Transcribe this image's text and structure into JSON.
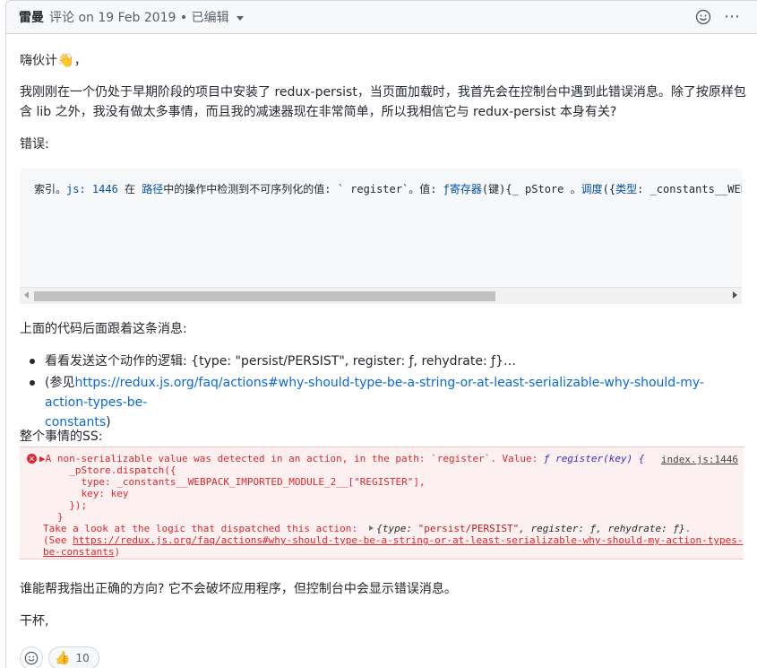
{
  "header": {
    "author": "雷曼",
    "meta": "评论 on 19 Feb 2019 • 已编辑"
  },
  "icons": {
    "smiley": "smiley-icon",
    "kebab": "kebab-icon",
    "wave": "waving-hand-icon",
    "error": "error-icon",
    "thumbs_up": "thumbs-up-icon"
  },
  "body": {
    "greeting": "嗨伙计",
    "greeting_suffix": "，",
    "intro_line1": "我刚刚在一个仍处于早期阶段的项目中安装了 redux-persist，当页面加载时，我首先会在控制台中遇到此错误消息。除了按原样包",
    "intro_line2": "含 lib 之外，我没有做太多事情，而且我的减速器现在非常简单，所以我相信它与 redux-persist 本身有关?",
    "error_label": "错误:",
    "code": {
      "p1": "索引。",
      "p2": "js: 1446",
      "p3": " 在 ",
      "p4": "路径",
      "p5": "中的操作中检测到不可序列化的值: ` register`。值: ",
      "p6": "ƒ",
      "p7": "寄存器",
      "p8": "(键){_ pStore 。",
      "p9": "调度",
      "p10": "({",
      "p11": "类型",
      "p12": ": _constants__WEBPACK"
    },
    "after_code": "上面的代码后面跟着这条消息:",
    "bullet1": "看看发送这个动作的逻辑: {type: \"persist/PERSIST\", register: ƒ, rehydrate: ƒ}…",
    "bullet2_prefix": "(参见",
    "bullet2_link_line1": "https://redux.js.org/faq/actions#why-should-type-be-a-string-or-at-least-serializable-why-should-my-action-types-be-",
    "bullet2_link_line2": "constants",
    "bullet2_suffix": ")",
    "ss_label": "整个事情的SS:",
    "question": "谁能帮我指出正确的方向? 它不会破坏应用程序，但控制台中会显示错误消息。",
    "signoff": "干杯,"
  },
  "console": {
    "line1_text": "▶A non-serializable value was detected in an action, in the path: `register`. Value: ",
    "line1_fn": "ƒ register(key) {",
    "source": "index.js:1446",
    "line2": "  _pStore.dispatch({",
    "line3": "    type: _constants__WEBPACK_IMPORTED_MODULE_2__[\"REGISTER\"],",
    "line4": "    key: key",
    "line5": "  });",
    "line6": "}",
    "line7_text": "Take a look at the logic that dispatched this action:  ",
    "line7_obj_a": "{type: ",
    "line7_obj_str": "\"persist/PERSIST\"",
    "line7_obj_b": ", register: ƒ, rehydrate: ƒ}",
    "line7_end": ".",
    "line8_prefix": "(See ",
    "line8_link": "https://redux.js.org/faq/actions#why-should-type-be-a-string-or-at-least-serializable-why-should-my-action-types-",
    "line9_link": "be-constants",
    "line9_suffix": ")"
  },
  "reactions": {
    "thumbs_up_count": "10"
  }
}
